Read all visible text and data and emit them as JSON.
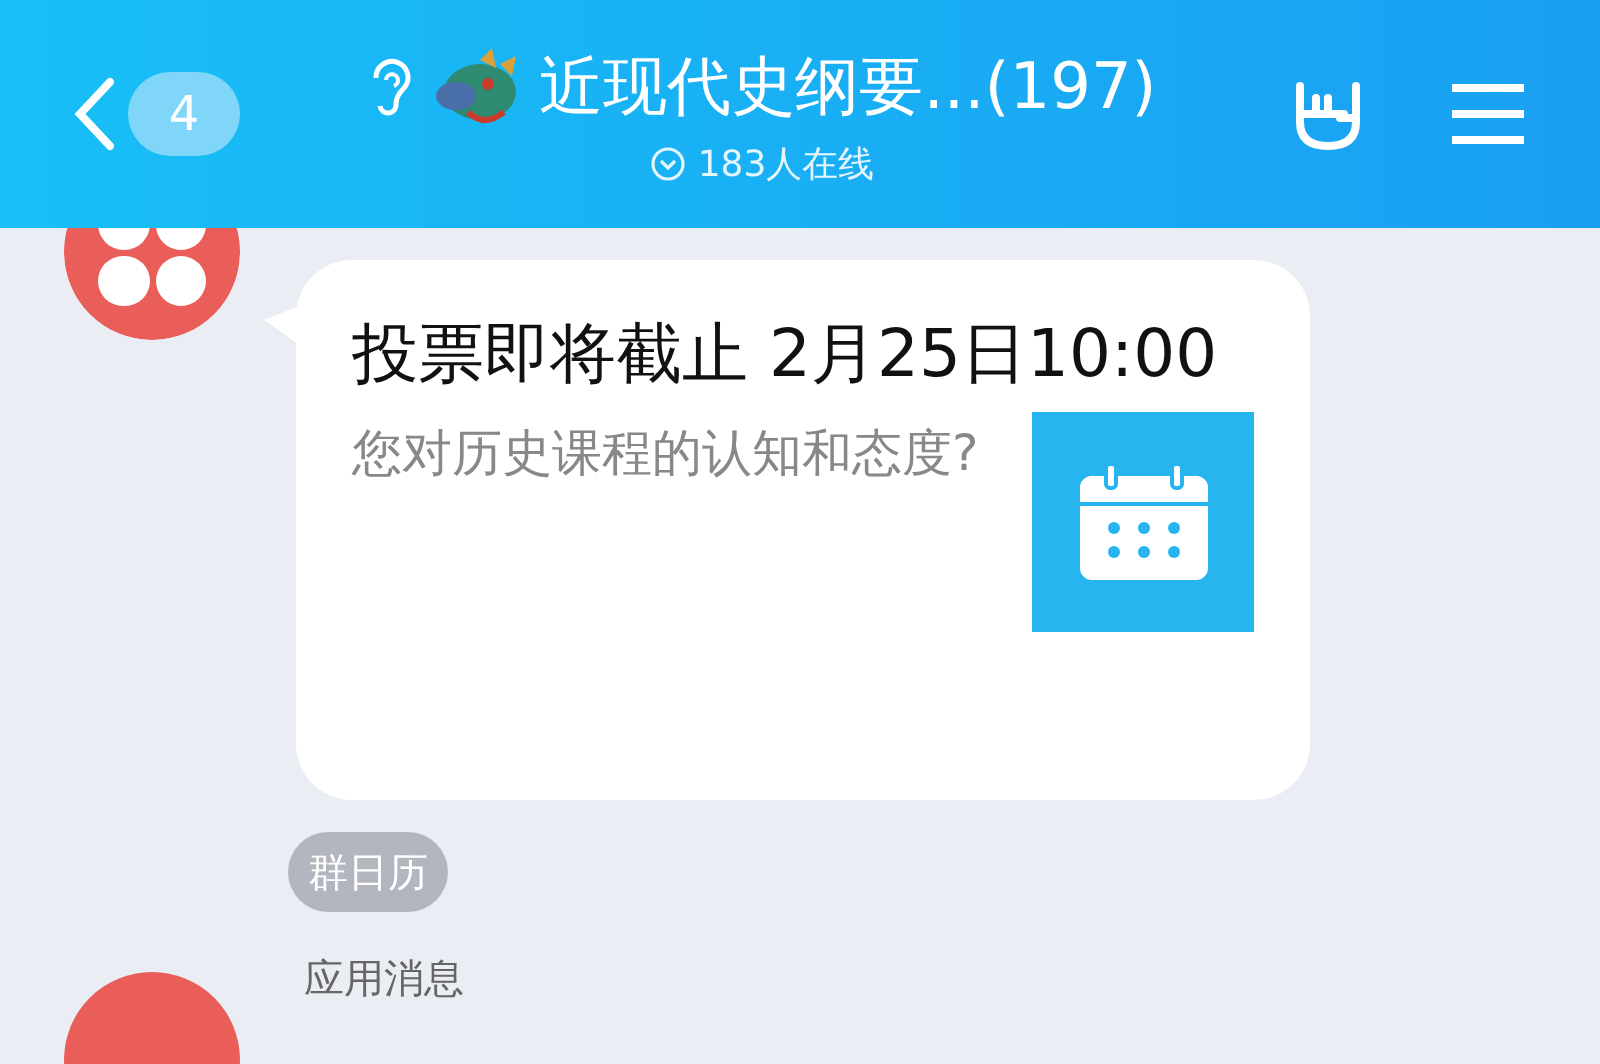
{
  "header": {
    "back_count": "4",
    "title": "近现代史纲要...(197)",
    "online": "183人在线"
  },
  "messages": [
    {
      "kind": "card",
      "title": "投票即将截止 2月25日10:00",
      "description": "您对历史课程的认知和态度?",
      "source": "群日历"
    },
    {
      "kind": "sender",
      "sender": "应用消息"
    }
  ]
}
